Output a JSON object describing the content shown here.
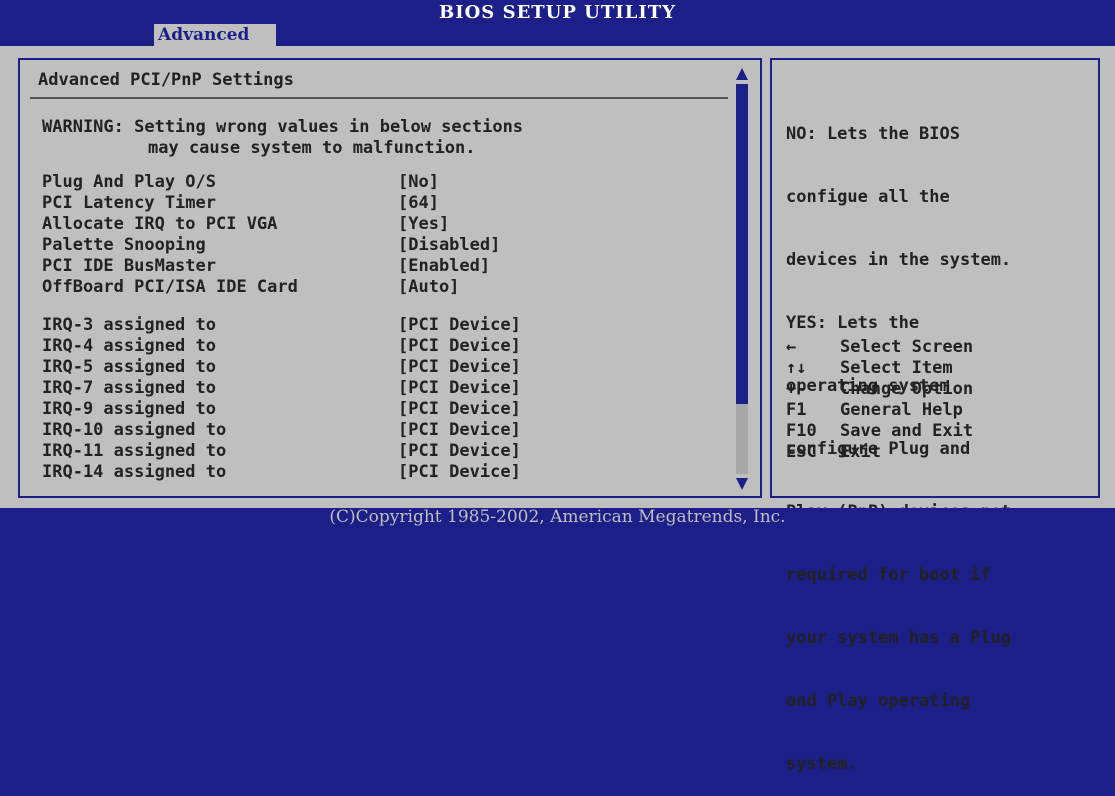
{
  "header": {
    "title": "BIOS SETUP UTILITY",
    "tab": "Advanced"
  },
  "main": {
    "heading": "Advanced PCI/PnP Settings",
    "warning_line1": "WARNING: Setting wrong values in below sections",
    "warning_line2": "may cause system to malfunction.",
    "settings": [
      {
        "label": "Plug And Play O/S",
        "value": "[No]"
      },
      {
        "label": "PCI Latency Timer",
        "value": "[64]"
      },
      {
        "label": "Allocate IRQ to PCI VGA",
        "value": "[Yes]"
      },
      {
        "label": "Palette Snooping",
        "value": "[Disabled]"
      },
      {
        "label": "PCI IDE BusMaster",
        "value": "[Enabled]"
      },
      {
        "label": "OffBoard PCI/ISA IDE Card",
        "value": "[Auto]"
      }
    ],
    "irq_settings": [
      {
        "label": "IRQ-3 assigned to",
        "value": "[PCI Device]"
      },
      {
        "label": "IRQ-4 assigned to",
        "value": "[PCI Device]"
      },
      {
        "label": "IRQ-5 assigned to",
        "value": "[PCI Device]"
      },
      {
        "label": "IRQ-7 assigned to",
        "value": "[PCI Device]"
      },
      {
        "label": "IRQ-9 assigned to",
        "value": "[PCI Device]"
      },
      {
        "label": "IRQ-10 assigned to",
        "value": "[PCI Device]"
      },
      {
        "label": "IRQ-11 assigned to",
        "value": "[PCI Device]"
      },
      {
        "label": "IRQ-14 assigned to",
        "value": "[PCI Device]"
      }
    ]
  },
  "help": {
    "lines": [
      "NO: Lets the BIOS",
      "configue all the",
      "devices in the system.",
      "YES: Lets the",
      "operating system",
      "configure Plug and",
      "Play (PnP) devices not",
      "required for boot if",
      "your system has a Plug",
      "and Play operating",
      "system."
    ],
    "keys": [
      {
        "key": "←",
        "desc": "Select Screen",
        "icon": "left-arrow-icon"
      },
      {
        "key": "↑↓",
        "desc": "Select Item",
        "icon": "up-down-arrow-icon"
      },
      {
        "key": "+-",
        "desc": "Change Option"
      },
      {
        "key": "F1",
        "desc": "General Help"
      },
      {
        "key": "F10",
        "desc": "Save and Exit"
      },
      {
        "key": "ESC",
        "desc": "Exit"
      }
    ]
  },
  "footer": {
    "copyright": "(C)Copyright 1985-2002, American Megatrends, Inc."
  },
  "colors": {
    "background": "#1c1f87",
    "panel": "#bfbfbf",
    "text": "#222222"
  }
}
